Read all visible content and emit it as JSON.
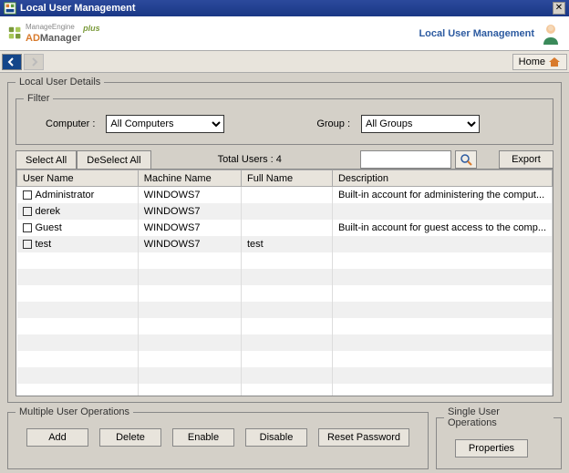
{
  "window": {
    "title": "Local User Management"
  },
  "logo": {
    "top": "ManageEngine",
    "ad": "AD",
    "manager": "Manager",
    "plus": "plus"
  },
  "header": {
    "title": "Local User Management"
  },
  "nav": {
    "home": "Home"
  },
  "details": {
    "legend": "Local User Details"
  },
  "filter": {
    "legend": "Filter",
    "computer_label": "Computer  :",
    "computer_value": "All Computers",
    "group_label": "Group  :",
    "group_value": "All Groups"
  },
  "actions": {
    "select_all": "Select All",
    "deselect_all": "DeSelect All",
    "total_users": "Total Users : 4",
    "export": "Export"
  },
  "columns": {
    "user": "User Name",
    "machine": "Machine Name",
    "full": "Full Name",
    "desc": "Description"
  },
  "rows": [
    {
      "user": "Administrator",
      "machine": "WINDOWS7",
      "full": "",
      "desc": "Built-in account for administering the comput..."
    },
    {
      "user": "derek",
      "machine": "WINDOWS7",
      "full": "",
      "desc": ""
    },
    {
      "user": "Guest",
      "machine": "WINDOWS7",
      "full": "",
      "desc": "Built-in account for guest access to the comp..."
    },
    {
      "user": "test",
      "machine": "WINDOWS7",
      "full": "test",
      "desc": ""
    }
  ],
  "multi": {
    "legend": "Multiple User Operations",
    "add": "Add",
    "delete": "Delete",
    "enable": "Enable",
    "disable": "Disable",
    "reset": "Reset Password"
  },
  "single": {
    "legend": "Single User Operations",
    "properties": "Properties"
  }
}
